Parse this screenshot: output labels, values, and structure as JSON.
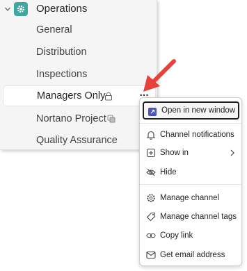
{
  "team": {
    "name": "Operations",
    "icon": "gear-icon",
    "color": "#3fa6a1"
  },
  "channels": [
    {
      "label": "General"
    },
    {
      "label": "Distribution"
    },
    {
      "label": "Inspections"
    },
    {
      "label": "Managers Only",
      "icon": "lock-icon",
      "selected": true
    },
    {
      "label": "Nortano Project",
      "icon": "shared-channel-icon"
    },
    {
      "label": "Quality Assurance"
    }
  ],
  "more_button": "...",
  "menu": {
    "items": [
      {
        "label": "Open in new window",
        "icon": "open-window-icon"
      },
      {
        "label": "Channel notifications",
        "icon": "bell-icon"
      },
      {
        "label": "Show in",
        "icon": "add-square-icon"
      },
      {
        "label": "Hide",
        "icon": "eye-off-icon"
      },
      {
        "label": "Manage channel",
        "icon": "gear-icon"
      },
      {
        "label": "Manage channel tags",
        "icon": "tag-icon"
      },
      {
        "label": "Copy link",
        "icon": "link-icon"
      },
      {
        "label": "Get email address",
        "icon": "mail-icon"
      }
    ]
  },
  "colors": {
    "accent_arrow": "#e8413a",
    "highlight_border": "#1f1f1f",
    "window_icon": "#4b53bc"
  }
}
